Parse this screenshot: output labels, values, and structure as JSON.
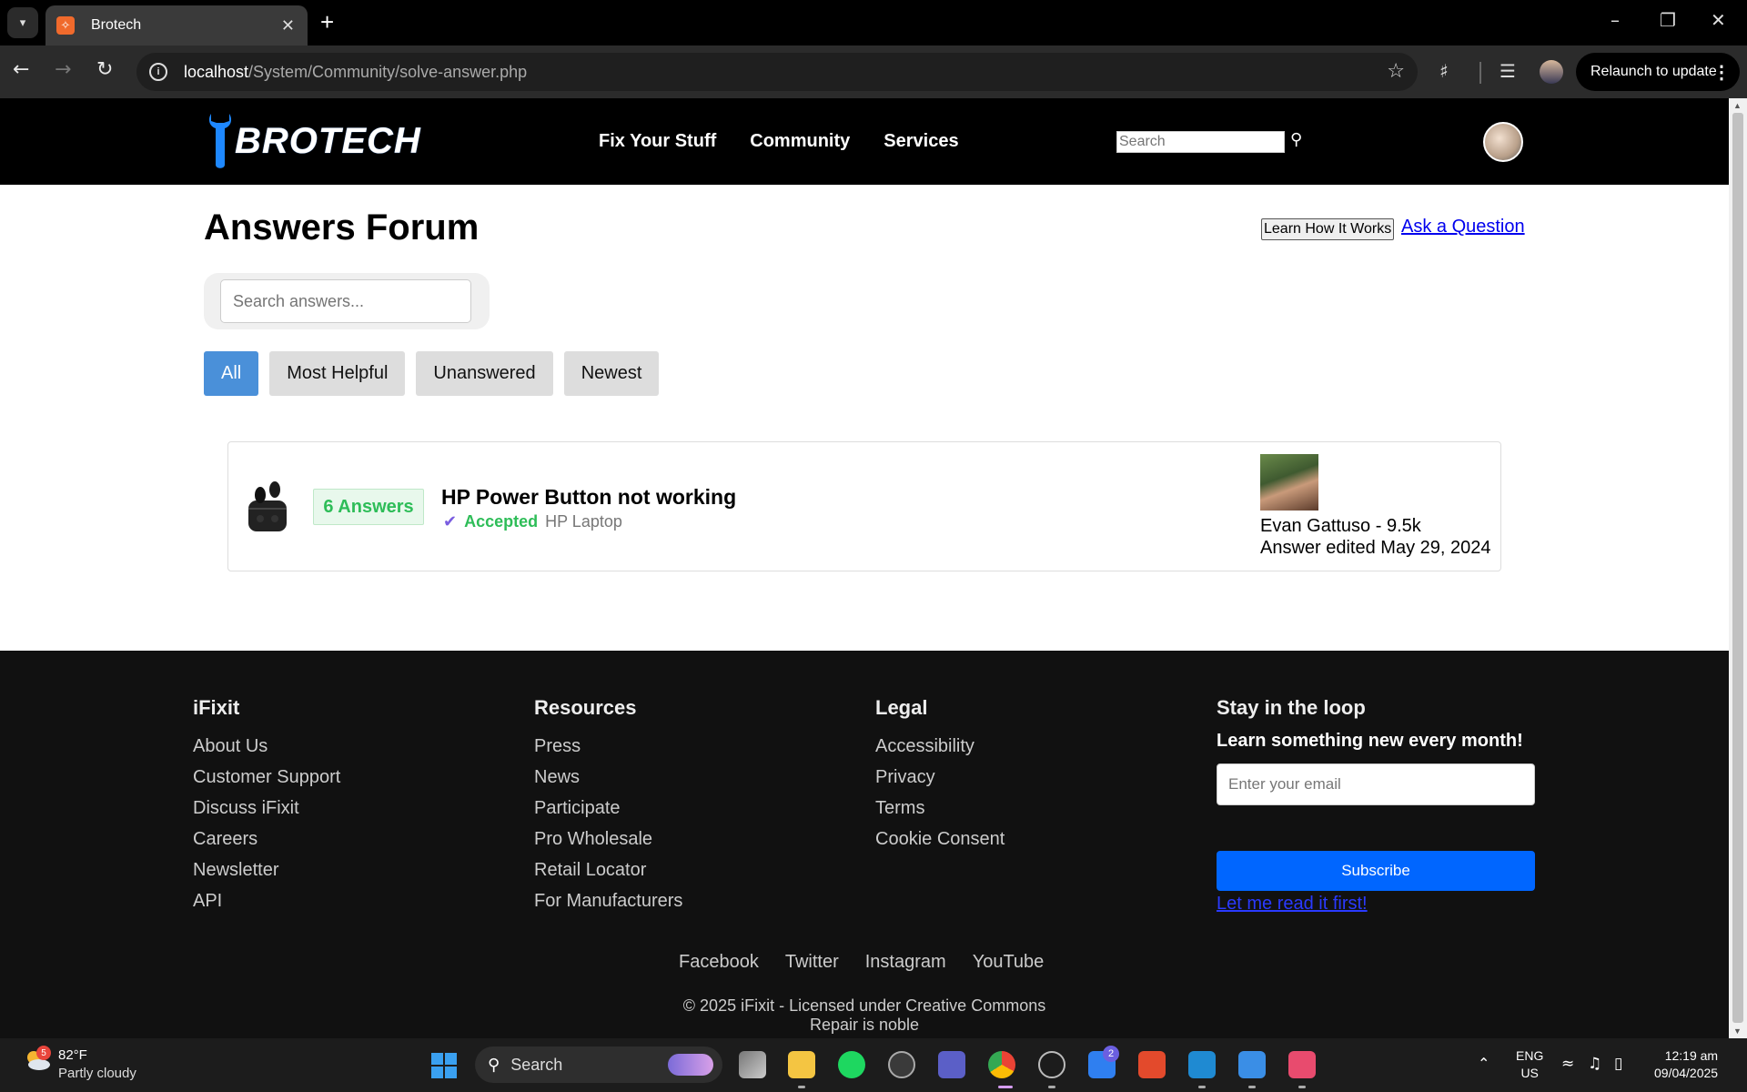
{
  "browser": {
    "tab_title": "Brotech",
    "url_host": "localhost",
    "url_path": "/System/Community/solve-answer.php",
    "relaunch_label": "Relaunch to update"
  },
  "header": {
    "logo_text": "BROTECH",
    "nav": [
      "Fix Your Stuff",
      "Community",
      "Services"
    ],
    "search_placeholder": "Search"
  },
  "main": {
    "title": "Answers Forum",
    "learn_button": "Learn How It Works",
    "ask_link": "Ask a Question",
    "search_placeholder": "Search answers...",
    "filters": [
      "All",
      "Most Helpful",
      "Unanswered",
      "Newest"
    ],
    "active_filter": "All"
  },
  "question": {
    "answers_count": "6 Answers",
    "title": "HP Power Button not working",
    "status": "Accepted",
    "device": "HP Laptop",
    "author": "Evan Gattuso - 9.5k",
    "edited": "Answer edited May 29, 2024"
  },
  "footer": {
    "col1": {
      "title": "iFixit",
      "links": [
        "About Us",
        "Customer Support",
        "Discuss iFixit",
        "Careers",
        "Newsletter",
        "API"
      ]
    },
    "col2": {
      "title": "Resources",
      "links": [
        "Press",
        "News",
        "Participate",
        "Pro Wholesale",
        "Retail Locator",
        "For Manufacturers"
      ]
    },
    "col3": {
      "title": "Legal",
      "links": [
        "Accessibility",
        "Privacy",
        "Terms",
        "Cookie Consent"
      ]
    },
    "newsletter": {
      "title": "Stay in the loop",
      "subtitle": "Learn something new every month!",
      "email_placeholder": "Enter your email",
      "subscribe_label": "Subscribe",
      "read_first": "Let me read it first!"
    },
    "social": [
      "Facebook",
      "Twitter",
      "Instagram",
      "YouTube"
    ],
    "copyright": "© 2025 iFixit - Licensed under Creative Commons",
    "tagline": "Repair is noble"
  },
  "taskbar": {
    "temperature": "82°F",
    "weather": "Partly cloudy",
    "weather_badge": "5",
    "search_label": "Search",
    "todo_badge": "2",
    "lang_line1": "ENG",
    "lang_line2": "US",
    "time": "12:19 am",
    "date": "09/04/2025"
  },
  "colors": {
    "accent_blue": "#4a90d9",
    "accepted_green": "#2ebd58",
    "subscribe_blue": "#0066ff"
  }
}
